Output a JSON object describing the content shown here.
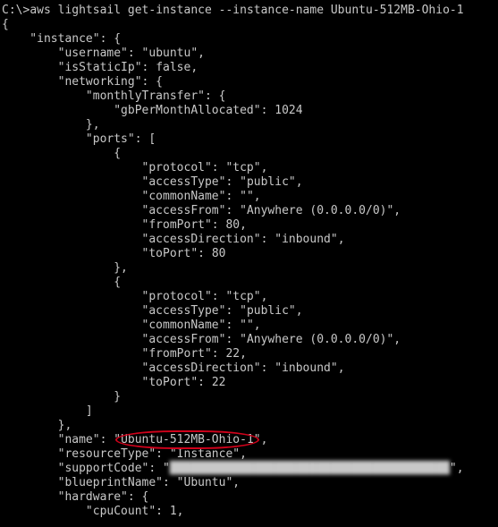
{
  "prompt": "C:\\>",
  "command": "aws lightsail get-instance --instance-name Ubuntu-512MB-Ohio-1",
  "output": {
    "instance": {
      "username": "ubuntu",
      "isStaticIp": "false",
      "networking": {
        "monthlyTransfer": {
          "gbPerMonthAllocated": "1024"
        },
        "ports": [
          {
            "protocol": "tcp",
            "accessType": "public",
            "commonName": "",
            "accessFrom": "Anywhere (0.0.0.0/0)",
            "fromPort": "80",
            "accessDirection": "inbound",
            "toPort": "80"
          },
          {
            "protocol": "tcp",
            "accessType": "public",
            "commonName": "",
            "accessFrom": "Anywhere (0.0.0.0/0)",
            "fromPort": "22",
            "accessDirection": "inbound",
            "toPort": "22"
          }
        ]
      },
      "name": "Ubuntu-512MB-Ohio-1",
      "resourceType": "Instance",
      "supportCode": "████████████████████████████████████████",
      "blueprintName": "Ubuntu",
      "hardware": {
        "cpuCount": "1"
      }
    }
  },
  "highlighted_value": "Ubuntu-512MB-Ohio-1",
  "chart_data": null
}
